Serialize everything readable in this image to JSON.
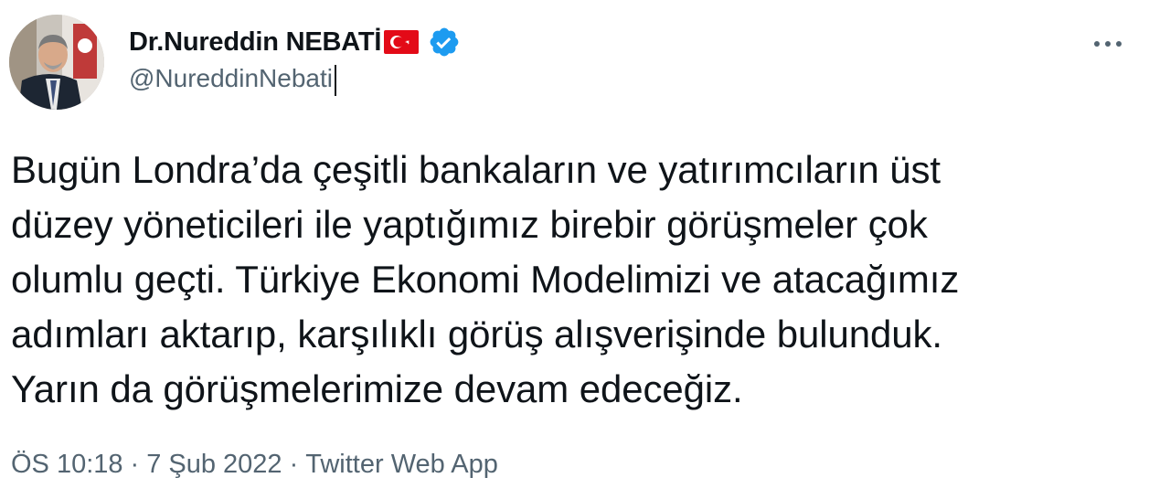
{
  "author": {
    "display_name": "Dr.Nureddin NEBATİ",
    "handle": "@NureddinNebati",
    "flag_icon": "turkey-flag-icon",
    "verified_icon": "verified-badge-icon"
  },
  "menu": {
    "icon": "more-horizontal-icon"
  },
  "tweet": {
    "text": "Bugün Londra’da çeşitli bankaların ve yatırımcıların üst\ndüzey yöneticileri ile yaptığımız birebir görüşmeler çok\nolumlu geçti. Türkiye Ekonomi Modelimizi ve atacağımız\nadımları aktarıp, karşılıklı görüş alışverişinde bulunduk.\nYarın da görüşmelerimize devam edeceğiz."
  },
  "meta": {
    "time": "ÖS 10:18",
    "separator": "·",
    "date": "7 Şub 2022",
    "source": "Twitter Web App"
  },
  "colors": {
    "text": "#0f1419",
    "secondary": "#536471",
    "verified": "#1d9bf0",
    "flag_red": "#e30a17"
  }
}
